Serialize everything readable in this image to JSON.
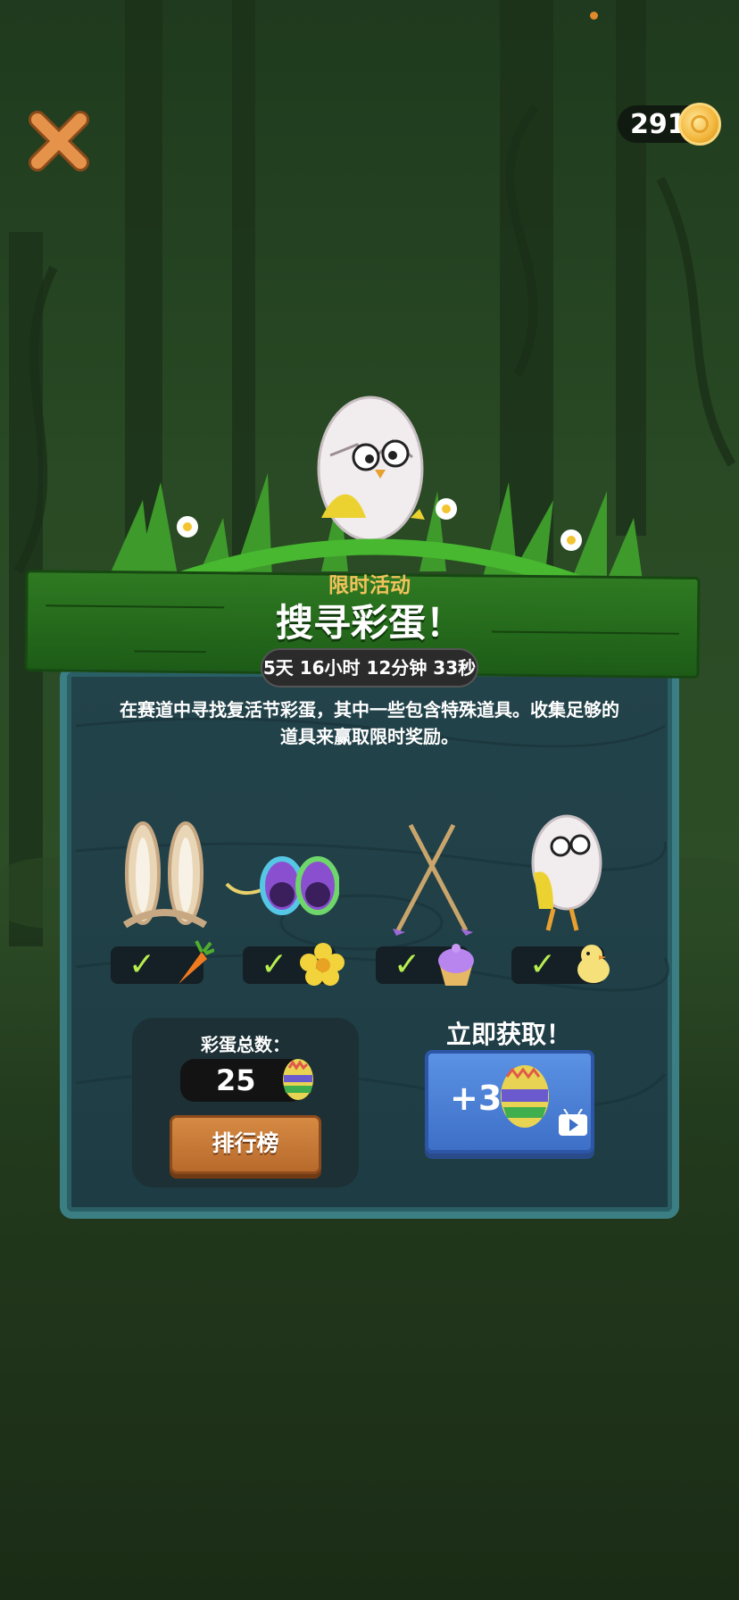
{
  "header": {
    "coins": "291"
  },
  "event": {
    "subtitle": "限时活动",
    "title": "搜寻彩蛋！",
    "timer": "5天 16小时 12分钟 33秒",
    "description_line1": "在赛道中寻找复活节彩蛋，其中一些包含特殊道具。收集足够的",
    "description_line2": "道具来赢取限时奖励。"
  },
  "rewards": [
    {
      "item": "bunny-ears-icon",
      "reward": "carrot-icon",
      "checked": true
    },
    {
      "item": "egg-glasses-icon",
      "reward": "daffodil-icon",
      "checked": true
    },
    {
      "item": "crossed-sticks-icon",
      "reward": "cupcake-icon",
      "checked": true
    },
    {
      "item": "hatching-egg-chick-icon",
      "reward": "chick-icon",
      "checked": true
    }
  ],
  "counter": {
    "label": "彩蛋总数：",
    "value": "25",
    "leaderboard_label": "排行榜"
  },
  "ad_offer": {
    "title": "立即获取！",
    "amount": "+3"
  },
  "colors": {
    "plank_green": "#2f7a22",
    "panel_teal": "#23434a",
    "check_green": "#b7ee4f",
    "subtitle_gold": "#f1c25b",
    "button_orange": "#d58a43",
    "button_blue": "#5b92e4"
  }
}
